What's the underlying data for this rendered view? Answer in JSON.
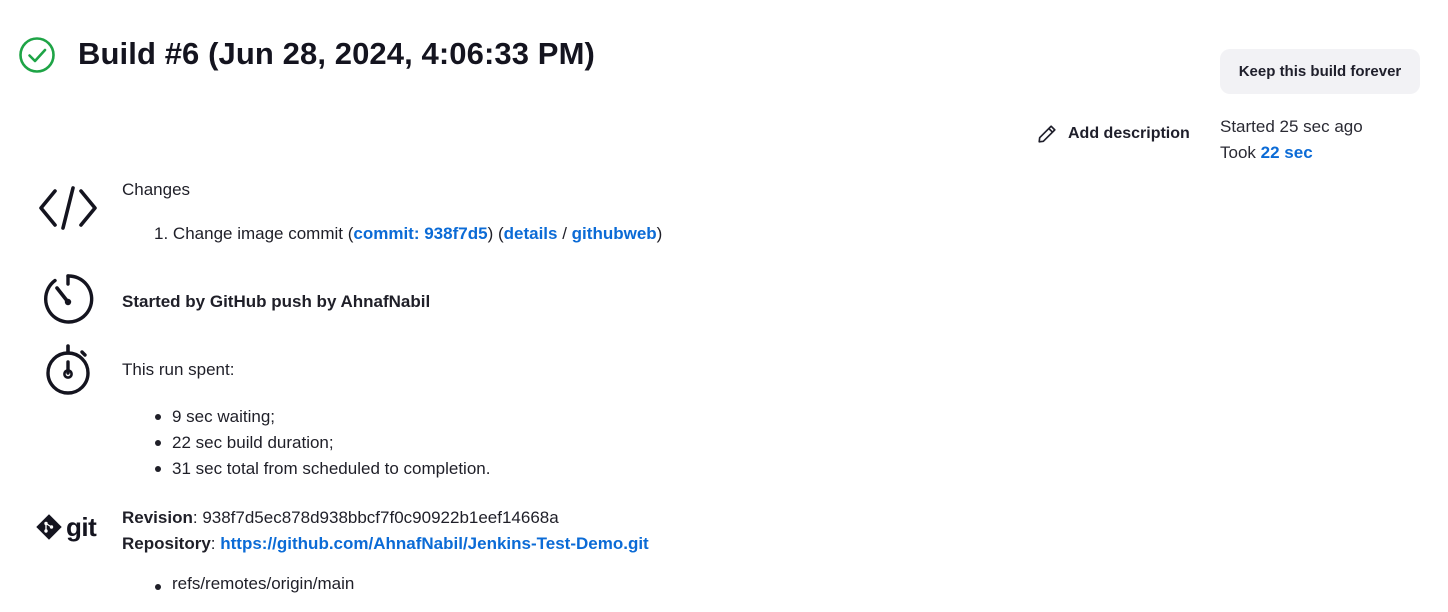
{
  "header": {
    "title": "Build #6 (Jun 28, 2024, 4:06:33 PM)",
    "status_icon": "check-circle-icon",
    "status_color": "#1ea446"
  },
  "actions": {
    "keep_forever_label": "Keep this build forever",
    "add_description_label": "Add description"
  },
  "build_info": {
    "started": "Started 25 sec ago",
    "took_prefix": "Took",
    "took_value": "22 sec"
  },
  "changes": {
    "heading": "Changes",
    "items": [
      {
        "number": "1.",
        "message": "Change image commit",
        "commit_label": "commit: 938f7d5",
        "details_label": "details",
        "separator": "/",
        "githubweb_label": "githubweb"
      }
    ]
  },
  "cause": {
    "label": "Started by GitHub push by AhnafNabil"
  },
  "timing": {
    "heading": "This run spent:",
    "items": [
      "9 sec waiting;",
      "22 sec build duration;",
      "31 sec total from scheduled to completion."
    ]
  },
  "git": {
    "logo_text": "git",
    "revision_label": "Revision",
    "revision_value": "938f7d5ec878d938bbcf7f0c90922b1eef14668a",
    "repository_label": "Repository",
    "repository_url": "https://github.com/AhnafNabil/Jenkins-Test-Demo.git",
    "refs": [
      "refs/remotes/origin/main"
    ]
  },
  "colors": {
    "link": "#0b6bd6",
    "text": "#1f1f28",
    "button_bg": "#f2f2f5"
  }
}
